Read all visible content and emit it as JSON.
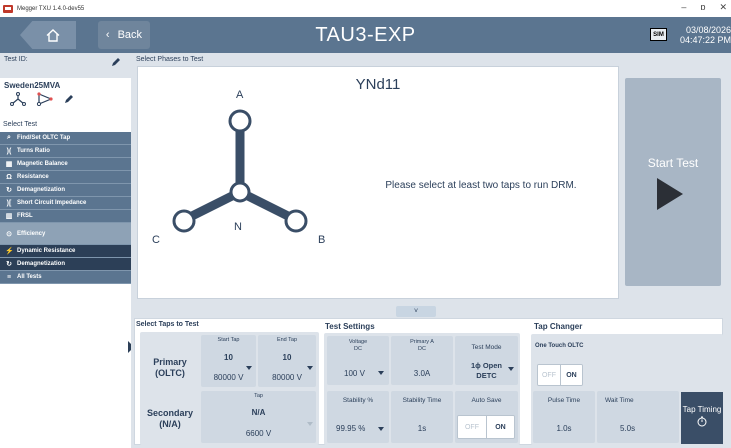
{
  "titlebar": {
    "app_title": "Megger TXU 1.4.0-dev55",
    "minimize": "–",
    "maximize": "ɒ",
    "close": "✕"
  },
  "header": {
    "back_label": "Back",
    "title": "TAU3-EXP",
    "sim_badge": "SIM",
    "date": "03/08/2026",
    "time": "04:47:22 PM"
  },
  "sidebar": {
    "test_id_label": "Test ID:",
    "config_name": "Sweden25MVA",
    "select_test_label": "Select Test",
    "tests": [
      {
        "label": "Find/Set OLTC Tap",
        "icon": "search-icon"
      },
      {
        "label": "Turns Ratio",
        "icon": "turns-ratio-icon"
      },
      {
        "label": "Magnetic Balance",
        "icon": "magnetic-balance-icon"
      },
      {
        "label": "Resistance",
        "icon": "resistance-icon"
      },
      {
        "label": "Demagnetization",
        "icon": "demagnetization-icon"
      },
      {
        "label": "Short Circuit Impedance",
        "icon": "short-circuit-icon"
      },
      {
        "label": "FRSL",
        "icon": "frsl-icon"
      },
      {
        "label": "Efficiency",
        "icon": "efficiency-icon"
      },
      {
        "label": "Dynamic Resistance",
        "icon": "dynamic-resistance-icon"
      },
      {
        "label": "Demagnetization",
        "icon": "demagnetization-icon"
      },
      {
        "label": "All Tests",
        "icon": "list-icon"
      }
    ]
  },
  "phases": {
    "section_label": "Select Phases to Test",
    "vector_group": "YNd11",
    "label_a": "A",
    "label_b": "B",
    "label_c": "C",
    "label_n": "N",
    "message": "Please select at least two taps to run DRM."
  },
  "start_button": {
    "label": "Start Test"
  },
  "collapse_icon": "˅",
  "taps": {
    "section_label": "Select Taps to Test",
    "primary_label_1": "Primary",
    "primary_label_2": "(OLTC)",
    "start_tap_caption": "Start Tap",
    "start_tap_value": "10",
    "start_tap_voltage": "80000 V",
    "end_tap_caption": "End Tap",
    "end_tap_value": "10",
    "end_tap_voltage": "80000 V",
    "secondary_label_1": "Secondary",
    "secondary_label_2": "(N/A)",
    "sec_tap_caption": "Tap",
    "sec_tap_value": "N/A",
    "sec_tap_voltage": "6600 V"
  },
  "test_settings": {
    "section_label": "Test Settings",
    "voltage_caption_1": "Voltage",
    "voltage_caption_2": "DC",
    "voltage_value": "100 V",
    "primary_a_caption_1": "Primary A",
    "primary_a_caption_2": "DC",
    "primary_a_value": "3.0A",
    "test_mode_caption": "Test Mode",
    "test_mode_value_1": "1ϕ Open",
    "test_mode_value_2": "DETC",
    "stability_caption": "Stability %",
    "stability_value": "99.95 %",
    "stability_time_caption": "Stability Time",
    "stability_time_value": "1s",
    "auto_save_caption": "Auto Save",
    "auto_save_off": "OFF",
    "auto_save_on": "ON"
  },
  "tap_changer": {
    "section_label": "Tap Changer",
    "one_touch_caption": "One Touch OLTC",
    "one_touch_off": "OFF",
    "one_touch_on": "ON",
    "pulse_time_caption": "Pulse Time",
    "pulse_time_value": "1.0s",
    "wait_time_caption": "Wait Time",
    "wait_time_value": "5.0s",
    "tap_timing_label": "Tap Timing"
  },
  "colors": {
    "header": "#5b7590",
    "sidebar_item": "#5b7590",
    "sidebar_selected": "#2c3f57",
    "panel_bg": "#dde3ea",
    "start_disabled": "#a8b6c5",
    "text": "#2b3f5a"
  }
}
